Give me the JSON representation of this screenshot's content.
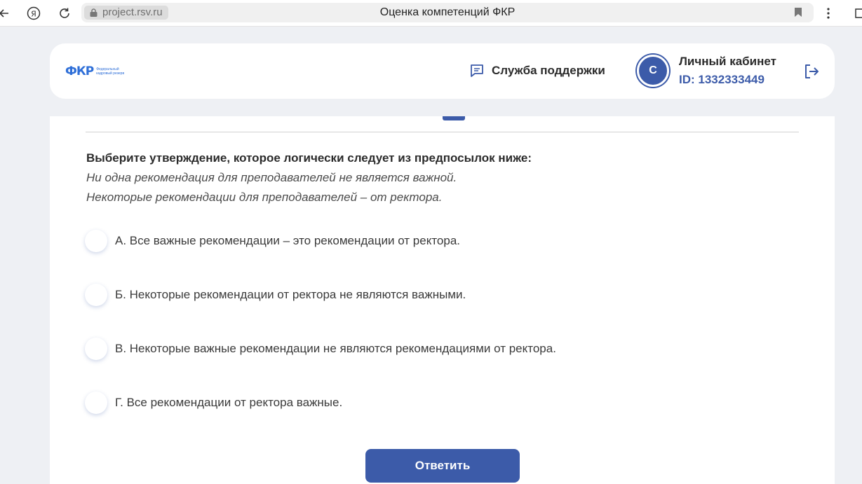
{
  "browser": {
    "url": "project.rsv.ru",
    "tab_title": "Оценка компетенций ФКР"
  },
  "header": {
    "logo_text": "ФКР",
    "logo_subtitle": "Федеральный кадровый резерв",
    "support_label": "Служба поддержки",
    "avatar_letter": "С",
    "account_title": "Личный кабинет",
    "account_id": "ID: 1332333449"
  },
  "quiz": {
    "question": "Выберите утверждение, которое логически следует из предпосылок ниже:",
    "premises": [
      "Ни одна рекомендация для преподавателей не является важной.",
      "Некоторые рекомендации для преподавателей – от ректора."
    ],
    "options": [
      "А. Все важные рекомендации – это рекомендации от ректора.",
      "Б. Некоторые рекомендации от ректора не являются важными.",
      "В. Некоторые важные рекомендации не являются рекомендациями от ректора.",
      "Г. Все рекомендации от ректора важные."
    ],
    "submit_label": "Ответить"
  },
  "colors": {
    "accent": "#3c5ba9",
    "page_bg": "#eef0f4"
  }
}
